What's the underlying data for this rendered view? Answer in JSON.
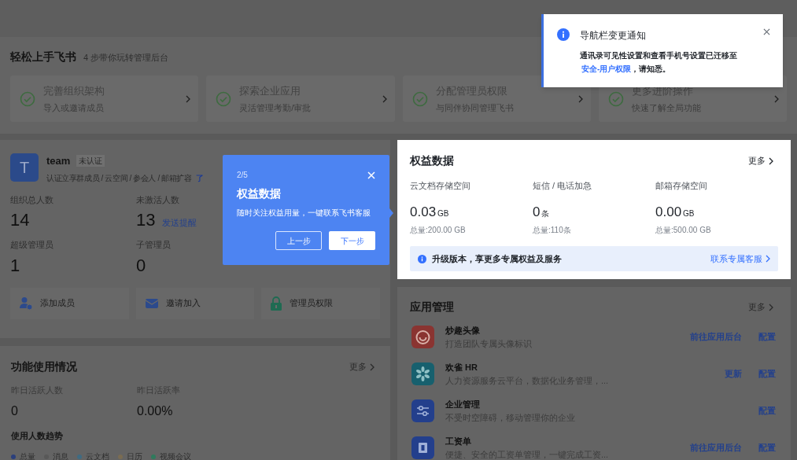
{
  "guide": {
    "title": "轻松上手飞书",
    "subtitle": "4 步带你玩转管理后台",
    "steps": [
      {
        "title": "完善组织架构",
        "desc": "导入或邀请成员",
        "done": true
      },
      {
        "title": "探索企业应用",
        "desc": "灵活管理考勤/审批",
        "done": true
      },
      {
        "title": "分配管理员权限",
        "desc": "与同伴协同管理飞书",
        "done": true
      },
      {
        "title": "更多进阶操作",
        "desc": "快速了解全局功能",
        "done": true
      }
    ]
  },
  "org": {
    "avatar": "T",
    "name": "team",
    "badge": "未认证",
    "promo": "认证立享群成员 / 云空间 / 参会人 / 邮箱扩容",
    "promo_link": "了",
    "stats": [
      {
        "label": "组织总人数",
        "value": "14"
      },
      {
        "label": "未激活人数",
        "value": "13",
        "link": "发送提醒"
      },
      {
        "label": "超级管理员",
        "value": "1"
      },
      {
        "label": "子管理员",
        "value": "0"
      }
    ],
    "actions": [
      {
        "label": "添加成员",
        "kind": "members"
      },
      {
        "label": "邀请加入",
        "kind": "mail"
      },
      {
        "label": "管理员权限",
        "kind": "lock"
      }
    ]
  },
  "usage": {
    "title": "功能使用情况",
    "more": "更多",
    "stats": [
      {
        "label": "昨日活跃人数",
        "value": "0"
      },
      {
        "label": "昨日活跃率",
        "value": "0.00%"
      }
    ],
    "trend_title": "使用人数趋势",
    "legend": [
      {
        "label": "总量",
        "color": "#2b3f7c"
      },
      {
        "label": "消息",
        "color": "#585858"
      },
      {
        "label": "云文档",
        "color": "#3f6b82"
      },
      {
        "label": "日历",
        "color": "#7a6c52"
      },
      {
        "label": "视频会议",
        "color": "#2f7a5c"
      }
    ]
  },
  "benefits": {
    "title": "权益数据",
    "more": "更多",
    "items": [
      {
        "label": "云文档存储空间",
        "value": "0.03",
        "unit": "GB",
        "total": "总量:200.00 GB"
      },
      {
        "label": "短信 / 电话加急",
        "value": "0",
        "unit": "条",
        "total": "总量:110条"
      },
      {
        "label": "邮箱存储空间",
        "value": "0.00",
        "unit": "GB",
        "total": "总量:500.00 GB"
      }
    ],
    "banner": "升级版本，享更多专属权益及服务",
    "banner_link": "联系专属客服"
  },
  "apps": {
    "title": "应用管理",
    "more": "更多",
    "items": [
      {
        "name": "炒趣头像",
        "desc": "打造团队专属头像标识",
        "actions": [
          "前往应用后台",
          "配置"
        ]
      },
      {
        "name": "欢雀 HR",
        "desc": "人力资源服务云平台，数据化业务管理，...",
        "actions": [
          "更新",
          "配置"
        ]
      },
      {
        "name": "企业管理",
        "desc": "不受时空障碍，移动管理你的企业",
        "actions": [
          "配置"
        ]
      },
      {
        "name": "工资单",
        "desc": "便捷、安全的工资单管理，一键完成工资...",
        "actions": [
          "前往应用后台",
          "配置"
        ]
      }
    ]
  },
  "tour": {
    "step": "2/5",
    "title": "权益数据",
    "text": "随时关注权益用量，一键联系飞书客服",
    "prev": "上一步",
    "next": "下一步"
  },
  "notice": {
    "title": "导航栏变更通知",
    "text": "通讯录可见性设置和查看手机号设置已迁移至",
    "link": "安全-用户权限",
    "suffix": "，请知悉。"
  }
}
